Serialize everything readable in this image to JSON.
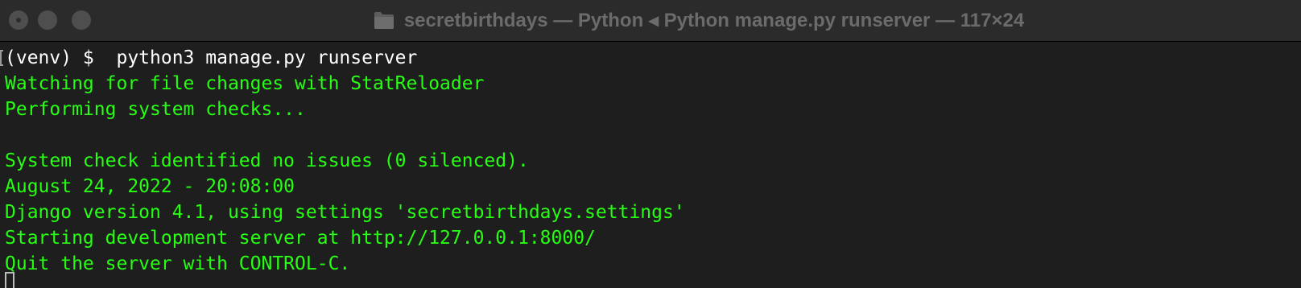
{
  "window": {
    "title": "secretbirthdays — Python ◂ Python manage.py runserver — 117×24",
    "folder_icon": "folder-icon"
  },
  "terminal": {
    "lines": [
      "(venv) $  python3 manage.py runserver",
      "Watching for file changes with StatReloader",
      "Performing system checks...",
      "",
      "System check identified no issues (0 silenced).",
      "August 24, 2022 - 20:08:00",
      "Django version 4.1, using settings 'secretbirthdays.settings'",
      "Starting development server at http://127.0.0.1:8000/",
      "Quit the server with CONTROL-C."
    ],
    "output_color": "#28fe14",
    "prompt_color": "#ffffff",
    "background": "#1e1e1e"
  }
}
